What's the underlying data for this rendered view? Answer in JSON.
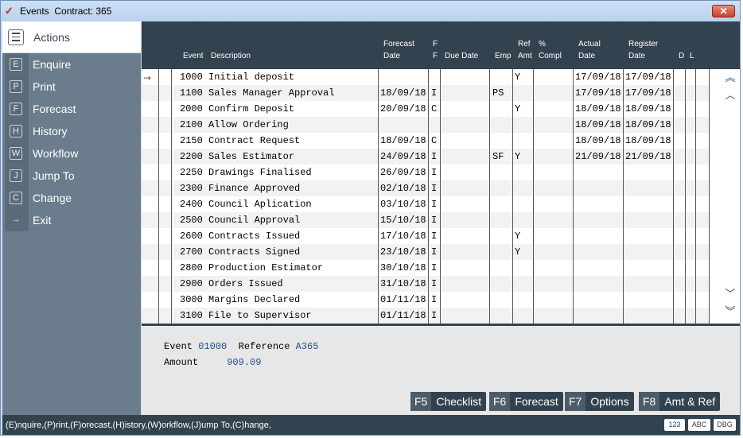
{
  "window": {
    "title": "Events  Contract: 365",
    "close_label": "✕",
    "app_icon": "✓"
  },
  "sidebar": {
    "title": "Actions",
    "items": [
      {
        "key": "E",
        "label": "Enquire"
      },
      {
        "key": "P",
        "label": "Print"
      },
      {
        "key": "F",
        "label": "Forecast"
      },
      {
        "key": "H",
        "label": "History"
      },
      {
        "key": "W",
        "label": "Workflow"
      },
      {
        "key": "J",
        "label": "Jump To"
      },
      {
        "key": "C",
        "label": "Change"
      },
      {
        "key": "→",
        "label": "Exit"
      }
    ]
  },
  "grid": {
    "headers": {
      "event": "Event",
      "description": "Description",
      "forecast_date_1": "Forecast",
      "forecast_date_2": "Date",
      "ff_1": "F",
      "ff_2": "F",
      "due_date": "Due Date",
      "emp": "Emp",
      "ref_amt_1": "Ref",
      "ref_amt_2": "Amt",
      "pct_compl_1": "%",
      "pct_compl_2": "Compl",
      "actual_date_1": "Actual",
      "actual_date_2": "Date",
      "register_date_1": "Register",
      "register_date_2": "Date",
      "d": "D",
      "l": "L"
    },
    "current_row_marker": "→",
    "rows": [
      {
        "event": "1000",
        "desc": "Initial deposit",
        "fdate": "",
        "ff": "",
        "due": "",
        "emp": "",
        "ref": "Y",
        "pct": "",
        "actual": "17/09/18",
        "register": "17/09/18"
      },
      {
        "event": "1100",
        "desc": "Sales Manager Approval",
        "fdate": "18/09/18",
        "ff": "I",
        "due": "",
        "emp": "PS",
        "ref": "",
        "pct": "",
        "actual": "17/09/18",
        "register": "17/09/18"
      },
      {
        "event": "2000",
        "desc": "Confirm Deposit",
        "fdate": "20/09/18",
        "ff": "C",
        "due": "",
        "emp": "",
        "ref": "Y",
        "pct": "",
        "actual": "18/09/18",
        "register": "18/09/18"
      },
      {
        "event": "2100",
        "desc": "Allow Ordering",
        "fdate": "",
        "ff": "",
        "due": "",
        "emp": "",
        "ref": "",
        "pct": "",
        "actual": "18/09/18",
        "register": "18/09/18"
      },
      {
        "event": "2150",
        "desc": "Contract Request",
        "fdate": "18/09/18",
        "ff": "C",
        "due": "",
        "emp": "",
        "ref": "",
        "pct": "",
        "actual": "18/09/18",
        "register": "18/09/18"
      },
      {
        "event": "2200",
        "desc": "Sales Estimator",
        "fdate": "24/09/18",
        "ff": "I",
        "due": "",
        "emp": "SF",
        "ref": "Y",
        "pct": "",
        "actual": "21/09/18",
        "register": "21/09/18"
      },
      {
        "event": "2250",
        "desc": "Drawings Finalised",
        "fdate": "26/09/18",
        "ff": "I",
        "due": "",
        "emp": "",
        "ref": "",
        "pct": "",
        "actual": "",
        "register": ""
      },
      {
        "event": "2300",
        "desc": "Finance Approved",
        "fdate": "02/10/18",
        "ff": "I",
        "due": "",
        "emp": "",
        "ref": "",
        "pct": "",
        "actual": "",
        "register": ""
      },
      {
        "event": "2400",
        "desc": "Council Aplication",
        "fdate": "03/10/18",
        "ff": "I",
        "due": "",
        "emp": "",
        "ref": "",
        "pct": "",
        "actual": "",
        "register": ""
      },
      {
        "event": "2500",
        "desc": "Council Approval",
        "fdate": "15/10/18",
        "ff": "I",
        "due": "",
        "emp": "",
        "ref": "",
        "pct": "",
        "actual": "",
        "register": ""
      },
      {
        "event": "2600",
        "desc": "Contracts Issued",
        "fdate": "17/10/18",
        "ff": "I",
        "due": "",
        "emp": "",
        "ref": "Y",
        "pct": "",
        "actual": "",
        "register": ""
      },
      {
        "event": "2700",
        "desc": "Contracts Signed",
        "fdate": "23/10/18",
        "ff": "I",
        "due": "",
        "emp": "",
        "ref": "Y",
        "pct": "",
        "actual": "",
        "register": ""
      },
      {
        "event": "2800",
        "desc": "Production Estimator",
        "fdate": "30/10/18",
        "ff": "I",
        "due": "",
        "emp": "",
        "ref": "",
        "pct": "",
        "actual": "",
        "register": ""
      },
      {
        "event": "2900",
        "desc": "Orders Issued",
        "fdate": "31/10/18",
        "ff": "I",
        "due": "",
        "emp": "",
        "ref": "",
        "pct": "",
        "actual": "",
        "register": ""
      },
      {
        "event": "3000",
        "desc": "Margins Declared",
        "fdate": "01/11/18",
        "ff": "I",
        "due": "",
        "emp": "",
        "ref": "",
        "pct": "",
        "actual": "",
        "register": ""
      },
      {
        "event": "3100",
        "desc": "File to Supervisor",
        "fdate": "01/11/18",
        "ff": "I",
        "due": "",
        "emp": "",
        "ref": "",
        "pct": "",
        "actual": "",
        "register": ""
      }
    ],
    "scroll": {
      "top": "︽",
      "up": "︿",
      "down": "﹀",
      "bottom": "︾"
    }
  },
  "detail": {
    "event_label": "Event",
    "event_value": "01000",
    "reference_label": "Reference",
    "reference_value": "A365",
    "amount_label": "Amount",
    "amount_value": "909.09"
  },
  "function_keys": [
    {
      "key": "F5",
      "label": "Checklist"
    },
    {
      "key": "F6",
      "label": "Forecast"
    },
    {
      "key": "F7",
      "label": "Options"
    },
    {
      "key": "F8",
      "label": "Amt & Ref"
    }
  ],
  "status": {
    "text": "(E)nquire,(P)rint,(F)orecast,(H)istory,(W)orkflow,(J)ump To,(C)hange,",
    "badges": [
      "123",
      "ABC",
      "DBG"
    ]
  }
}
